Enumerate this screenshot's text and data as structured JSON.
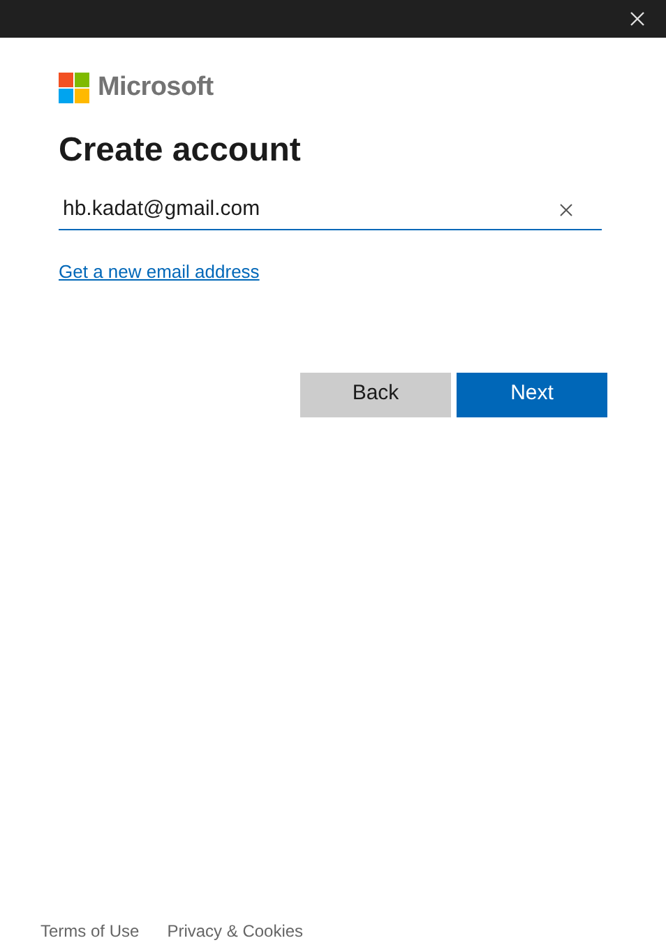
{
  "brand": "Microsoft",
  "title": "Create account",
  "email_field": {
    "value": "hb.kadat@gmail.com"
  },
  "link": "Get a new email address",
  "buttons": [
    {
      "label": "Back",
      "kind": "secondary"
    },
    {
      "label": "Next",
      "kind": "primary"
    }
  ],
  "footer": [
    "Terms of Use",
    "Privacy & Cookies"
  ]
}
